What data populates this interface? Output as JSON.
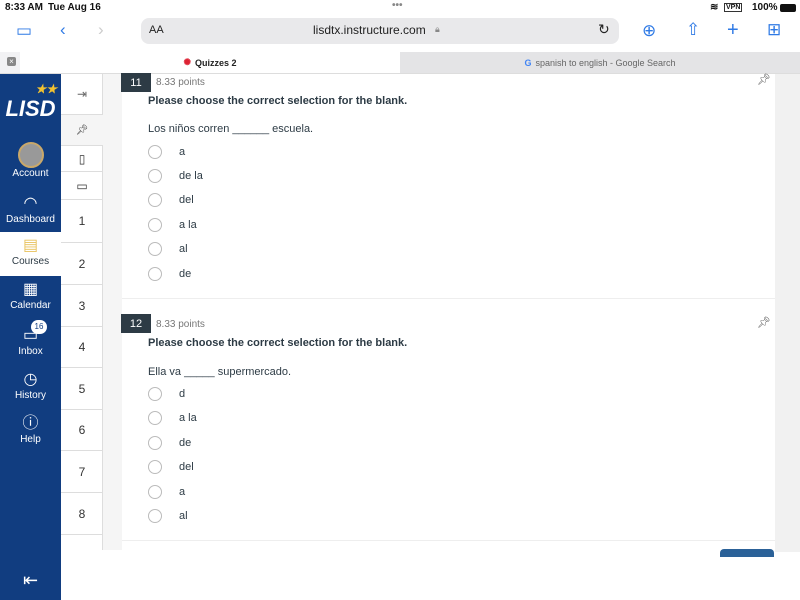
{
  "status": {
    "time": "8:33 AM",
    "date": "Tue Aug 16",
    "vpn": "VPN",
    "battery": "100%"
  },
  "browser": {
    "text_size": "AA",
    "url": "lisdtx.instructure.com",
    "tabs": [
      {
        "label": "Quizzes 2",
        "active": true
      },
      {
        "label": "spanish to english - Google Search",
        "active": false
      }
    ]
  },
  "global_nav": {
    "logo": "LISD",
    "items": [
      {
        "label": "Account",
        "icon": "avatar"
      },
      {
        "label": "Dashboard",
        "icon": "gauge-icon"
      },
      {
        "label": "Courses",
        "icon": "book-icon",
        "active": true
      },
      {
        "label": "Calendar",
        "icon": "calendar-icon"
      },
      {
        "label": "Inbox",
        "icon": "inbox-icon",
        "badge": "16"
      },
      {
        "label": "History",
        "icon": "clock-icon"
      },
      {
        "label": "Help",
        "icon": "info-icon"
      }
    ]
  },
  "question_nav": {
    "items": [
      "1",
      "2",
      "3",
      "4",
      "5",
      "6",
      "7",
      "8"
    ]
  },
  "questions": [
    {
      "number": "11",
      "points": "8.33 points",
      "title": "Please choose the correct selection for the blank.",
      "text": "Los niños corren ______ escuela.",
      "answers": [
        "a",
        "de la",
        "del",
        "a la",
        "al",
        "de"
      ]
    },
    {
      "number": "12",
      "points": "8.33 points",
      "title": "Please choose the correct selection for the blank.",
      "text": "Ella va _____ supermercado.",
      "answers": [
        "d",
        "a la",
        "de",
        "del",
        "a",
        "al"
      ]
    }
  ],
  "colors": {
    "nav": "#113d80",
    "accent": "#2f7ae5"
  }
}
